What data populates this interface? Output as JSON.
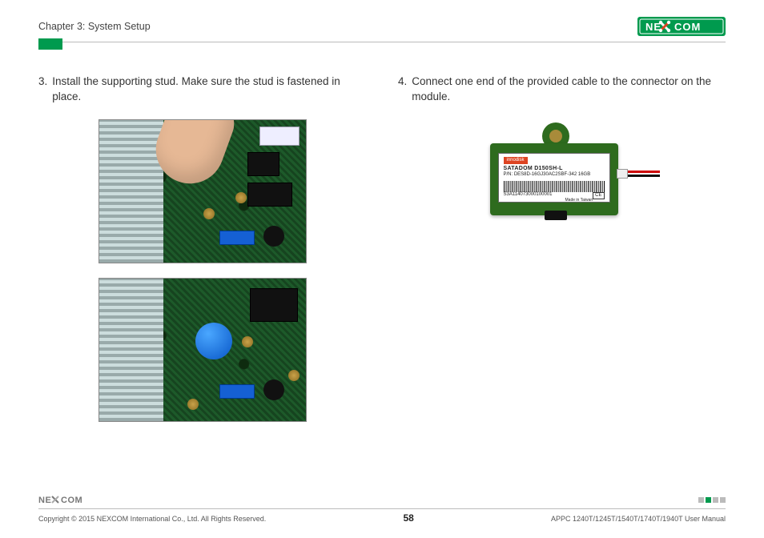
{
  "header": {
    "chapter": "Chapter 3: System Setup",
    "brand": "NEXCOM"
  },
  "steps": {
    "left": {
      "num": "3.",
      "text": "Install the supporting stud. Make sure the stud is fastened in place."
    },
    "right": {
      "num": "4.",
      "text": "Connect one end of the provided cable to the connector on the module."
    }
  },
  "module_label": {
    "brand": "innodisk",
    "model": "SATADOM D150SH-L",
    "pn": "P/N: DES8D-16GJ30AC2SBF-342  16GB",
    "serial": "S3A114073000100001",
    "cert": "CE",
    "made": "Made in Taiwan"
  },
  "footer": {
    "copyright": "Copyright © 2015 NEXCOM International Co., Ltd. All Rights Reserved.",
    "page": "58",
    "doc": "APPC 1240T/1245T/1540T/1740T/1940T User Manual"
  }
}
